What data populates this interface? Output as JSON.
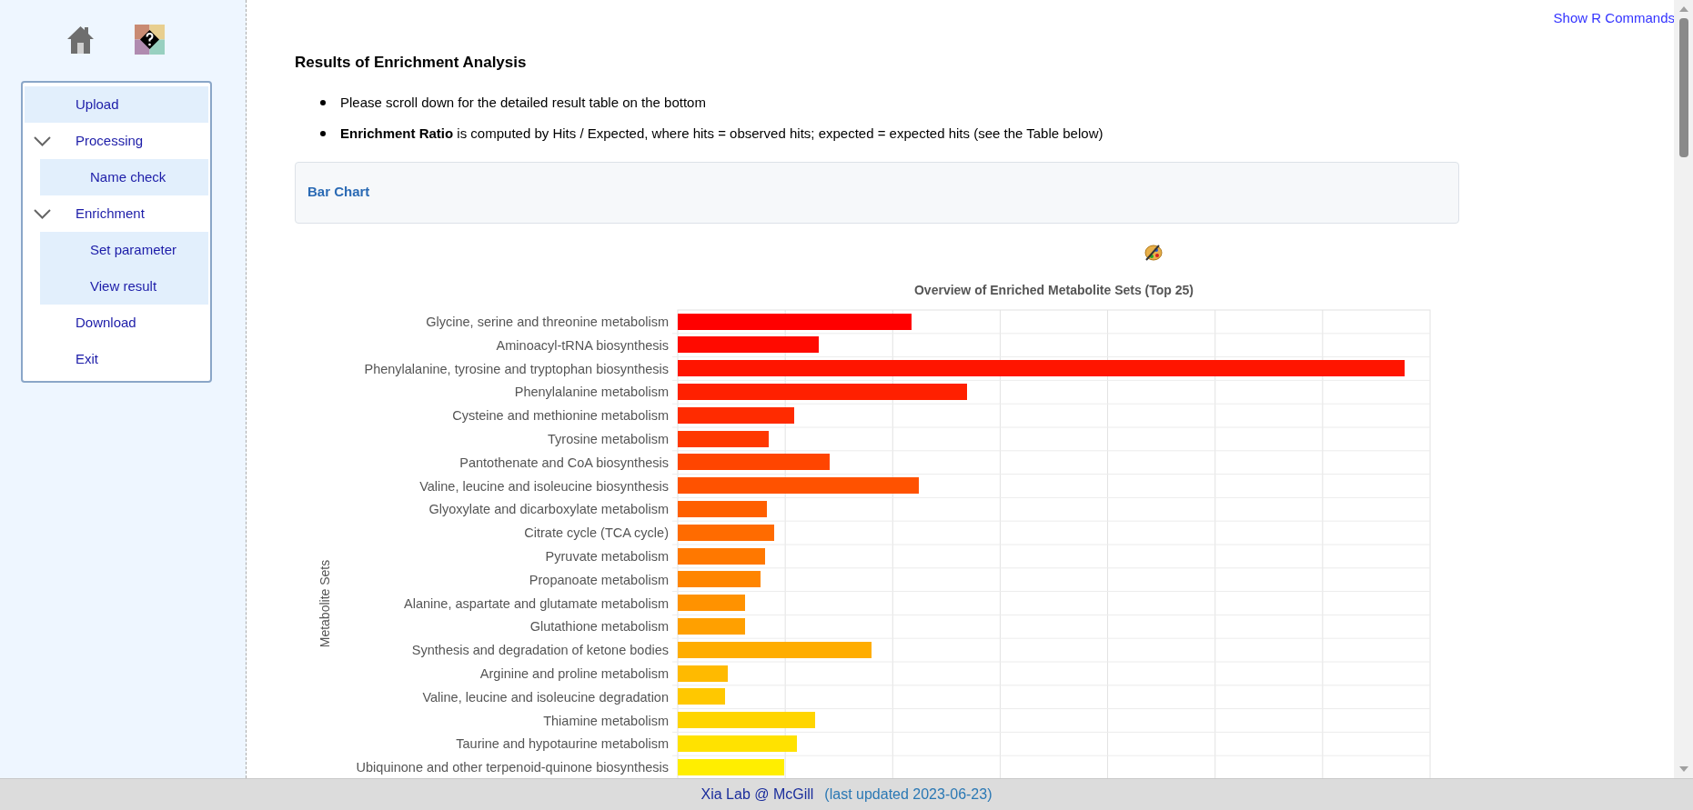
{
  "sidebar": {
    "menu": [
      {
        "label": "Upload",
        "selected": true
      },
      {
        "label": "Processing",
        "expanded": true,
        "children": [
          {
            "label": "Name check",
            "selected": false
          }
        ]
      },
      {
        "label": "Enrichment",
        "expanded": true,
        "children": [
          {
            "label": "Set parameter",
            "selected": false
          },
          {
            "label": "View result",
            "selected": false
          }
        ]
      },
      {
        "label": "Download",
        "selected": false
      },
      {
        "label": "Exit",
        "selected": false
      }
    ]
  },
  "top_link": "Show R Commands",
  "heading": "Results of Enrichment Analysis",
  "bullets": [
    "Please scroll down for the detailed result table on the bottom",
    "**Enrichment Ratio** is computed by Hits / Expected, where hits = observed hits; expected = expected hits (see the Table below)"
  ],
  "panel": {
    "title": "Bar Chart"
  },
  "chart": {
    "title": "Overview of Enriched Metabolite Sets (Top 25)",
    "ylabel": "Metabolite Sets",
    "bars": [
      {
        "label": "Glycine, serine and threonine metabolism",
        "color": "#ff0000"
      },
      {
        "label": "Aminoacyl-tRNA biosynthesis",
        "color": "#ff0a00"
      },
      {
        "label": "Phenylalanine, tyrosine and tryptophan biosynthesis",
        "color": "#ff1500"
      },
      {
        "label": "Phenylalanine metabolism",
        "color": "#ff2000"
      },
      {
        "label": "Cysteine and methionine metabolism",
        "color": "#ff2b00"
      },
      {
        "label": "Tyrosine metabolism",
        "color": "#ff3800"
      },
      {
        "label": "Pantothenate and CoA biosynthesis",
        "color": "#ff4500"
      },
      {
        "label": "Valine, leucine and isoleucine biosynthesis",
        "color": "#ff5200"
      },
      {
        "label": "Glyoxylate and dicarboxylate metabolism",
        "color": "#ff5f00"
      },
      {
        "label": "Citrate cycle (TCA cycle)",
        "color": "#ff6b00"
      },
      {
        "label": "Pyruvate metabolism",
        "color": "#ff7800"
      },
      {
        "label": "Propanoate metabolism",
        "color": "#ff8500"
      },
      {
        "label": "Alanine, aspartate and glutamate metabolism",
        "color": "#ff9200"
      },
      {
        "label": "Glutathione metabolism",
        "color": "#ffa000"
      },
      {
        "label": "Synthesis and degradation of ketone bodies",
        "color": "#ffad00"
      },
      {
        "label": "Arginine and proline metabolism",
        "color": "#ffba00"
      },
      {
        "label": "Valine, leucine and isoleucine degradation",
        "color": "#ffc800"
      },
      {
        "label": "Thiamine metabolism",
        "color": "#ffd500"
      },
      {
        "label": "Taurine and hypotaurine metabolism",
        "color": "#ffe200"
      },
      {
        "label": "Ubiquinone and other terpenoid-quinone biosynthesis",
        "color": "#ffee00"
      }
    ]
  },
  "footer": {
    "lab": "Xia Lab @ McGill",
    "updated": "(last updated 2023-06-23)"
  }
}
